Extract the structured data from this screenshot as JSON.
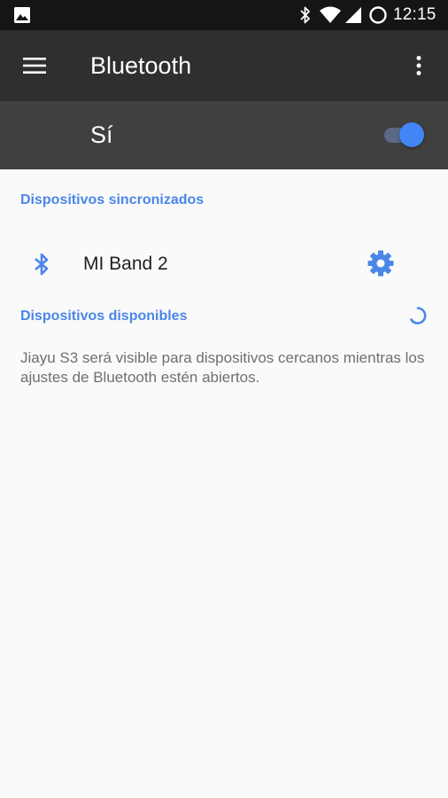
{
  "status_bar": {
    "time": "12:15",
    "icons": [
      "gallery-icon",
      "bluetooth-icon",
      "wifi-icon",
      "signal-icon",
      "battery-icon"
    ]
  },
  "app_bar": {
    "title": "Bluetooth",
    "menu_icon": "menu-icon",
    "overflow_icon": "more-vert-icon"
  },
  "master_switch": {
    "label": "Sí",
    "state": "on",
    "accent_color": "#4285f4"
  },
  "paired_section": {
    "header": "Dispositivos sincronizados",
    "devices": [
      {
        "name": "MI Band 2",
        "icon": "bluetooth-icon",
        "action_icon": "gear-icon"
      }
    ]
  },
  "available_section": {
    "header": "Dispositivos disponibles",
    "status_icon": "spinner-icon",
    "info": "Jiayu S3 será visible para dispositivos cercanos mientras los ajustes de Bluetooth estén abiertos."
  },
  "colors": {
    "accent": "#4a86e8",
    "app_bar": "#2f2f2f",
    "switch_bar": "#404040",
    "status_bar": "#151515",
    "background": "#fafafa"
  }
}
